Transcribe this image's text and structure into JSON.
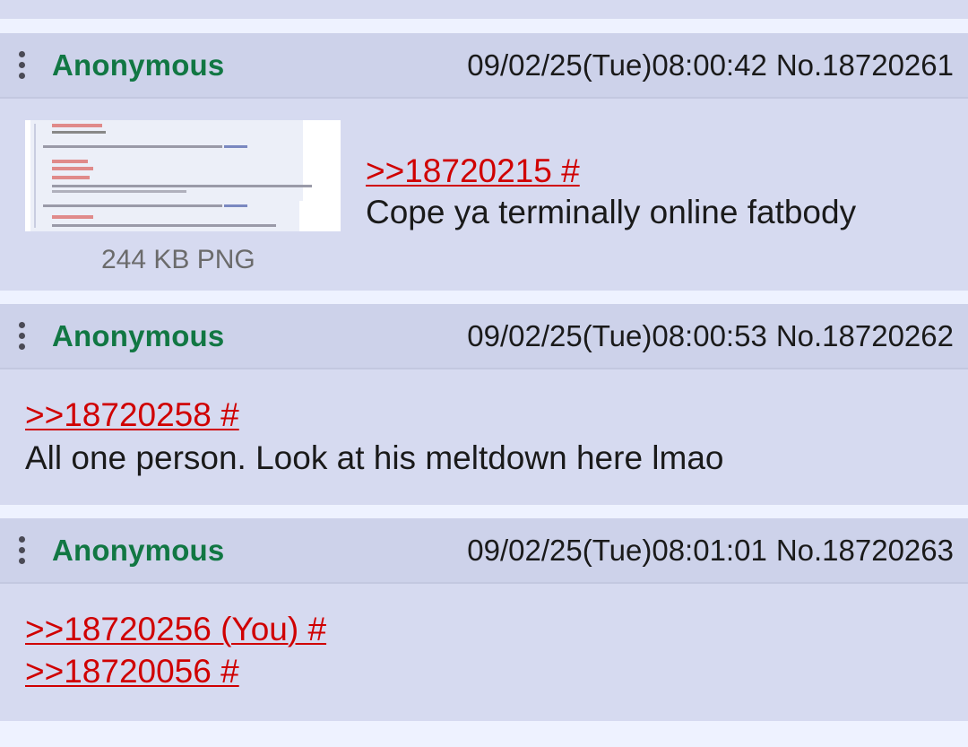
{
  "posts": [
    {
      "name": "Anonymous",
      "datetime": "09/02/25(Tue)08:00:42",
      "number": "No.18720261",
      "file": {
        "info": "244 KB PNG"
      },
      "quotes": [
        ">>18720215 #"
      ],
      "text": "Cope ya terminally online fatbody"
    },
    {
      "name": "Anonymous",
      "datetime": "09/02/25(Tue)08:00:53",
      "number": "No.18720262",
      "quotes": [
        ">>18720258 #"
      ],
      "text": "All one person. Look at his meltdown here lmao"
    },
    {
      "name": "Anonymous",
      "datetime": "09/02/25(Tue)08:01:01",
      "number": "No.18720263",
      "quotes": [
        ">>18720256 (You) #",
        ">>18720056 #"
      ]
    }
  ],
  "colors": {
    "name": "#117743",
    "quote_link": "#d00000",
    "post_bg": "#d6daf0",
    "header_bg": "#cdd2ea",
    "page_bg": "#eef2ff"
  },
  "icons": {
    "post_menu": "vertical-ellipsis-icon"
  }
}
